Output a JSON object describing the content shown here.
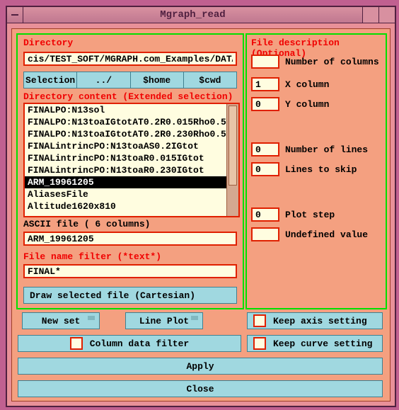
{
  "title": "Mgraph_read",
  "left": {
    "dir_label": "Directory",
    "dir_value": "cis/TEST_SOFT/MGRAPH.com_Examples/DATA/",
    "navs": [
      "Selection",
      "../",
      "$home",
      "$cwd"
    ],
    "content_label": "Directory content (Extended selection)",
    "items": [
      "FINALPO:N13sol",
      "FINALPO:N13toaIGtotAT0.2R0.015Rho0.5",
      "FINALPO:N13toaIGtotAT0.2R0.230Rho0.5",
      "FINALintrincPO:N13toaAS0.2IGtot",
      "FINALintrincPO:N13toaR0.015IGtot",
      "FINALintrincPO:N13toaR0.230IGtot",
      "ARM_19961205",
      "AliasesFile",
      "Altitude1620x810"
    ],
    "selected": 6,
    "ascii_label": "ASCII file (   6 columns)",
    "ascii_value": "ARM_19961205",
    "filter_label": "File name filter (*text*)",
    "filter_value": "FINAL*"
  },
  "right": {
    "header": "File description (Optional)",
    "ncol": "",
    "ncol_l": "Number of columns",
    "xcol": "1",
    "xcol_l": "X column",
    "ycol": "0",
    "ycol_l": "Y column",
    "nlin": "0",
    "nlin_l": "Number of lines",
    "skip": "0",
    "skip_l": "Lines to skip",
    "step": "0",
    "step_l": "Plot step",
    "undef": "",
    "undef_l": "Undefined value"
  },
  "bottom": {
    "draw": "Draw selected file (Cartesian)",
    "newset": "New set",
    "lineplot": "Line Plot",
    "colfilter": "Column data filter",
    "keepaxis": "Keep axis setting",
    "keepcurve": "Keep curve setting",
    "apply": "Apply",
    "close": "Close"
  }
}
